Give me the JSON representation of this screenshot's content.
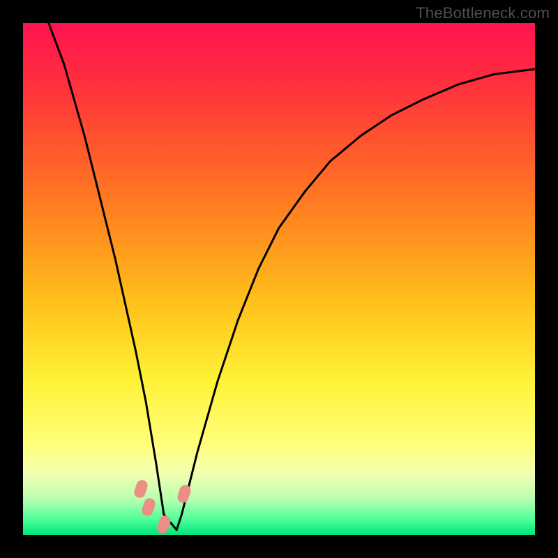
{
  "watermark": "TheBottleneck.com",
  "colors": {
    "frame": "#000000",
    "marker": "#eb8e85",
    "curve": "#000000",
    "gradient_stops": [
      {
        "pct": 0,
        "color": "#ff1450"
      },
      {
        "pct": 10,
        "color": "#ff2a40"
      },
      {
        "pct": 25,
        "color": "#ff5a2b"
      },
      {
        "pct": 40,
        "color": "#ff8c1e"
      },
      {
        "pct": 55,
        "color": "#ffc21a"
      },
      {
        "pct": 70,
        "color": "#fff238"
      },
      {
        "pct": 82,
        "color": "#ffff7a"
      },
      {
        "pct": 88,
        "color": "#f3ffb0"
      },
      {
        "pct": 93,
        "color": "#b8ffb0"
      },
      {
        "pct": 97,
        "color": "#4dff9a"
      },
      {
        "pct": 100,
        "color": "#00e57a"
      }
    ]
  },
  "chart_data": {
    "type": "line",
    "title": "",
    "xlabel": "",
    "ylabel": "",
    "xlim": [
      0,
      100
    ],
    "ylim": [
      0,
      100
    ],
    "note": "x is a normalized horizontal position (0–100); y is the curve height (0=bottom/green, 100=top/red). Values estimated from pixels.",
    "series": [
      {
        "name": "bottleneck-curve",
        "x": [
          5,
          8,
          10,
          12,
          14,
          16,
          18,
          20,
          22,
          24,
          26,
          27.5,
          30,
          31,
          34,
          38,
          42,
          46,
          50,
          55,
          60,
          66,
          72,
          78,
          85,
          92,
          100
        ],
        "y": [
          100,
          92,
          85,
          78,
          70,
          62,
          54,
          45,
          36,
          26,
          14,
          4,
          1,
          4,
          16,
          30,
          42,
          52,
          60,
          67,
          73,
          78,
          82,
          85,
          88,
          90,
          91
        ]
      }
    ],
    "markers": [
      {
        "name": "pt-left-upper",
        "x": 23.0,
        "y": 9.0
      },
      {
        "name": "pt-left-mid",
        "x": 24.5,
        "y": 5.5
      },
      {
        "name": "pt-trough",
        "x": 27.5,
        "y": 2.0
      },
      {
        "name": "pt-right",
        "x": 31.5,
        "y": 8.0
      }
    ]
  }
}
